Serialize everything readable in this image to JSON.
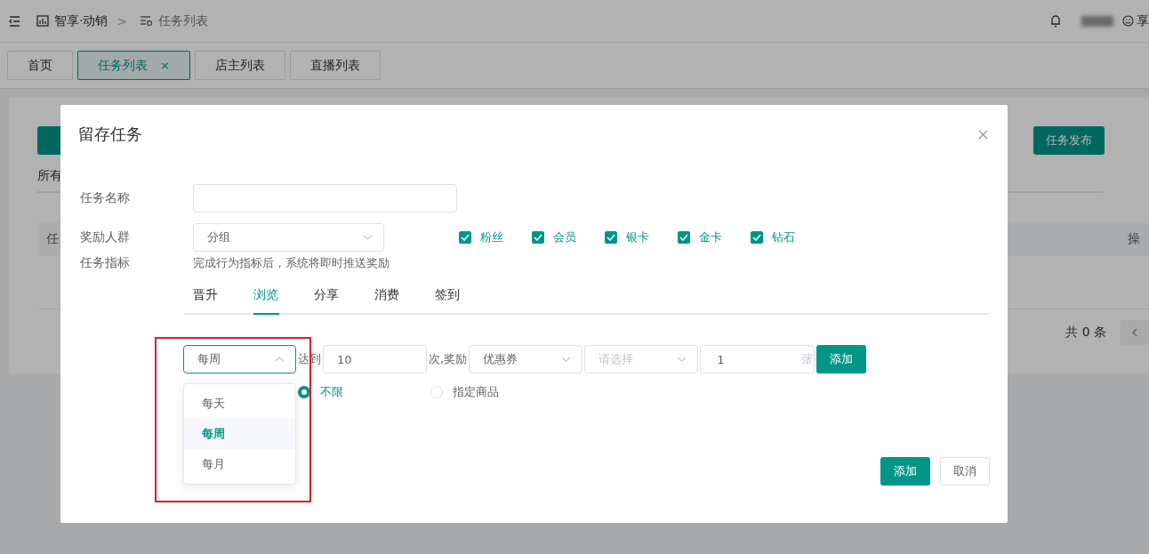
{
  "header": {
    "breadcrumb": [
      {
        "label": "智享·动销"
      },
      {
        "label": "任务列表"
      }
    ],
    "separator": ">",
    "user_initial": "享"
  },
  "tabs": [
    {
      "label": "首页",
      "selected": false,
      "closable": false
    },
    {
      "label": "任务列表",
      "selected": true,
      "closable": true
    },
    {
      "label": "店主列表",
      "selected": false,
      "closable": false
    },
    {
      "label": "直播列表",
      "selected": false,
      "closable": false
    }
  ],
  "tab_close": "×",
  "page": {
    "publish_button": "任务发布",
    "filter_label": "所有",
    "columns": [
      "任",
      "操"
    ],
    "total": "共 0 条"
  },
  "dialog": {
    "title": "留存任务",
    "name_field": {
      "label": "任务名称"
    },
    "audience": {
      "label": "奖励人群",
      "value": "分组",
      "options": [
        {
          "label": "粉丝",
          "checked": true
        },
        {
          "label": "会员",
          "checked": true
        },
        {
          "label": "银卡",
          "checked": true
        },
        {
          "label": "金卡",
          "checked": true
        },
        {
          "label": "钻石",
          "checked": true
        }
      ]
    },
    "metric": {
      "label": "任务指标",
      "hint": "完成行为指标后，系统将即时推送奖励"
    },
    "metric_tabs": [
      {
        "label": "晋升",
        "selected": false
      },
      {
        "label": "浏览",
        "selected": true
      },
      {
        "label": "分享",
        "selected": false
      },
      {
        "label": "消费",
        "selected": false
      },
      {
        "label": "签到",
        "selected": false
      }
    ],
    "rule": {
      "period": {
        "value": "每周",
        "open": true,
        "options": [
          {
            "label": "每天",
            "selected": false
          },
          {
            "label": "每周",
            "selected": true
          },
          {
            "label": "每月",
            "selected": false
          }
        ]
      },
      "reach_label": "达到",
      "count": "10",
      "reward_label": "次,奖励",
      "reward_type": "优惠券",
      "coupon_placeholder": "请选择",
      "quantity": "1",
      "unit": "张",
      "add_button": "添加"
    },
    "scope": [
      {
        "label": "不限",
        "selected": true
      },
      {
        "label": "指定商品",
        "selected": false
      }
    ],
    "buttons": [
      {
        "label": "添加",
        "kind": "primary"
      },
      {
        "label": "取消",
        "kind": "default"
      }
    ]
  }
}
